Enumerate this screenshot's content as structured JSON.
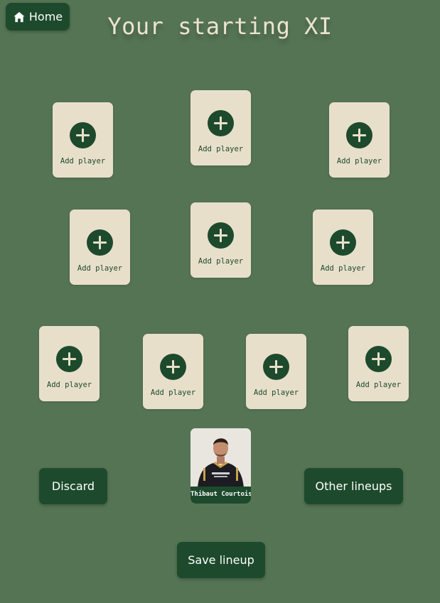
{
  "nav": {
    "home_label": "Home",
    "home_icon": "home-icon"
  },
  "header": {
    "title": "Your starting XI"
  },
  "slots": {
    "add_label": "Add player",
    "add_icon": "plus-circle-icon"
  },
  "goalkeeper": {
    "name": "Thibaut Courtois"
  },
  "actions": {
    "discard_label": "Discard",
    "other_lineups_label": "Other lineups",
    "save_label": "Save lineup"
  },
  "colors": {
    "background": "#557454",
    "accent_dark": "#1d4a2c",
    "card": "#e8dfcb",
    "title": "#ece4cf"
  }
}
